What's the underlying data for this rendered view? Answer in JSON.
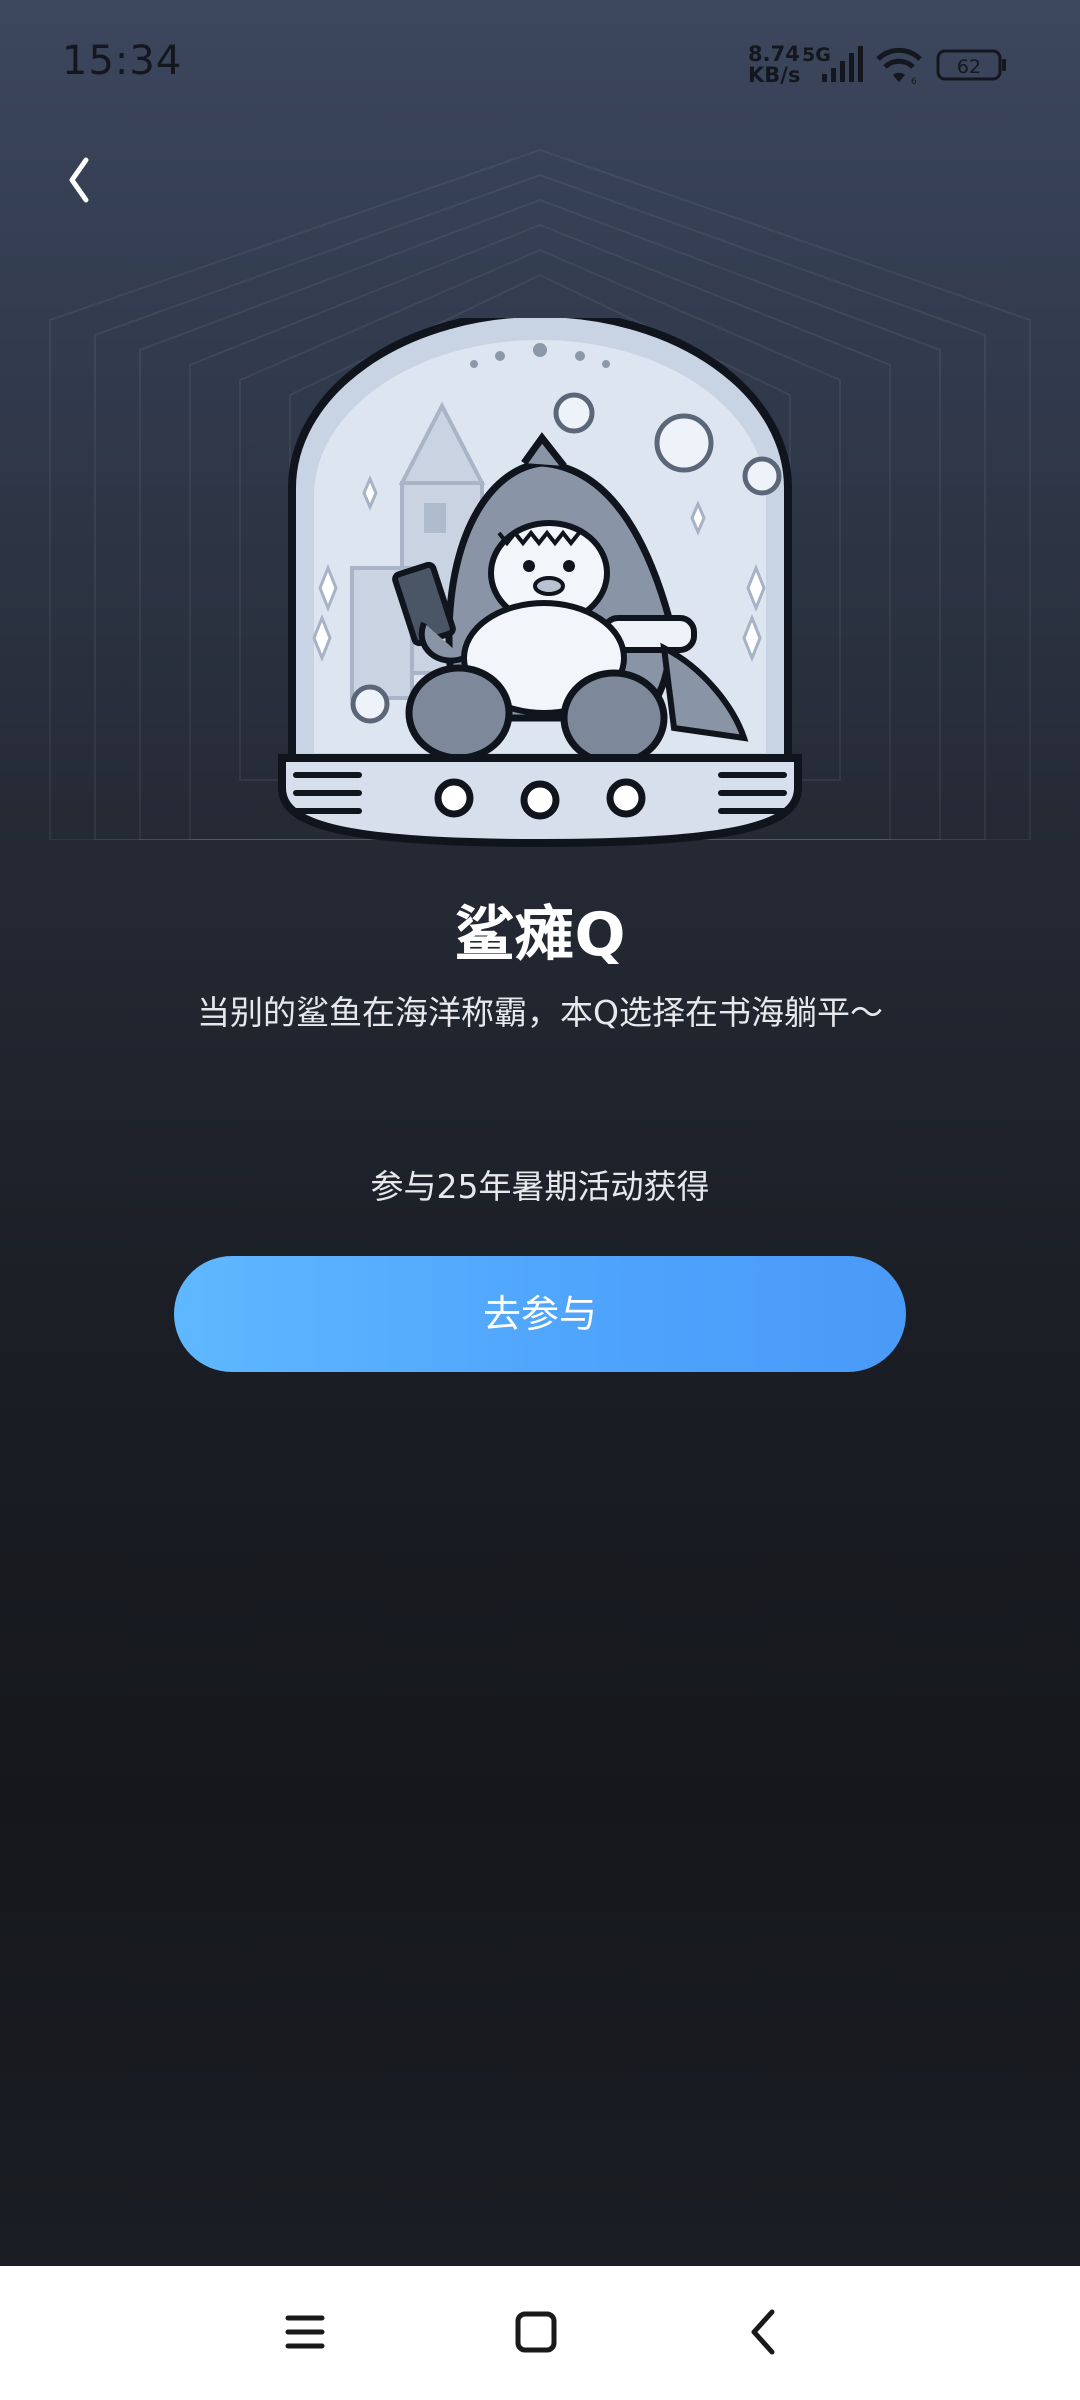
{
  "status_bar": {
    "time": "15:34",
    "net_speed_value": "8.74",
    "net_speed_unit": "KB/s",
    "network_type": "5G",
    "battery_level": "62"
  },
  "header": {
    "back_icon": "chevron-left-icon"
  },
  "badge": {
    "name": "鲨瘫Q",
    "description": "当别的鲨鱼在海洋称霸，本Q选择在书海躺平～",
    "obtain_text": "参与25年暑期活动获得",
    "action_label": "去参与",
    "image_icon": "snow-globe-shark-penguin-icon"
  },
  "nav_bar": {
    "menu_icon": "menu-icon",
    "home_icon": "home-square-icon",
    "back_icon": "back-triangle-icon"
  },
  "colors": {
    "button_start": "#5fb8ff",
    "button_end": "#4a9af8",
    "background_top": "#3c465d",
    "background_bottom": "#15171c"
  }
}
